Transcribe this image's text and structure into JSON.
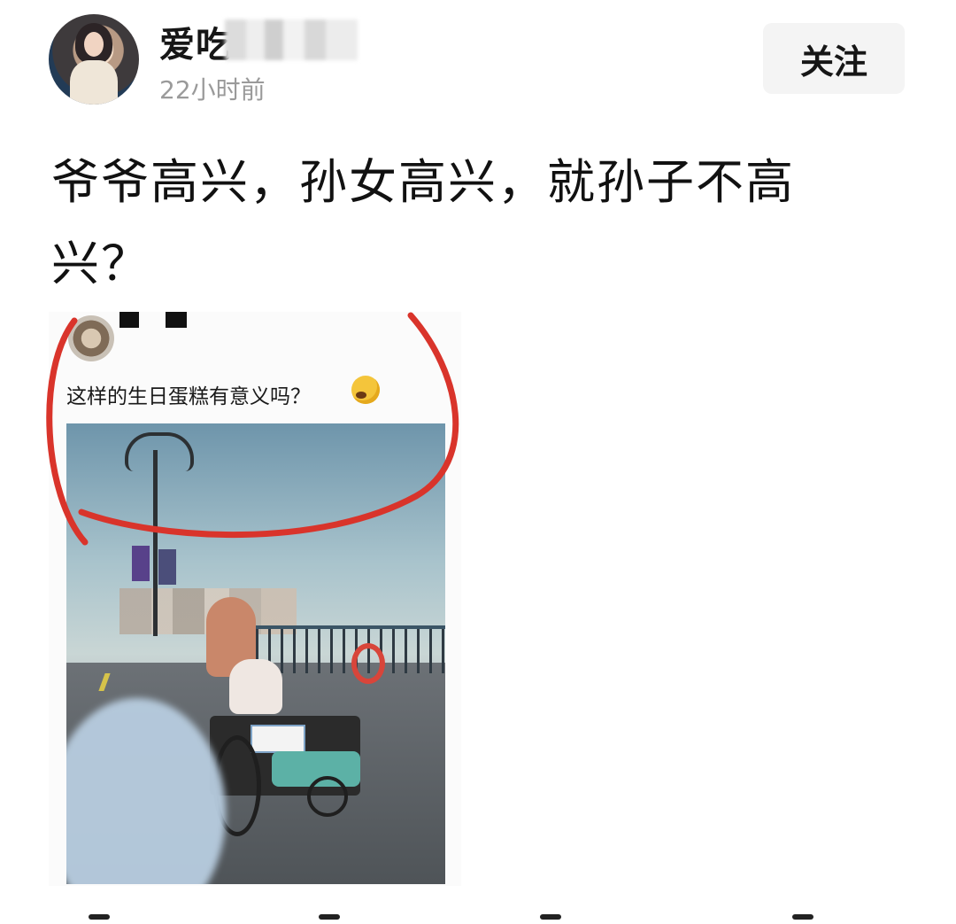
{
  "post": {
    "username": "爱吃",
    "timestamp": "22小时前",
    "follow_label": "关注",
    "text": "爷爷高兴，孙女高兴，就孙子不高兴？"
  },
  "shared_card": {
    "caption": "这样的生日蛋糕有意义吗？"
  },
  "icons": {
    "emoji": "grinning-sweat-emoji-icon"
  },
  "colors": {
    "annotation_red": "#d9342b",
    "follow_button_bg": "#f4f4f4",
    "timestamp_gray": "#9a9a9a"
  }
}
